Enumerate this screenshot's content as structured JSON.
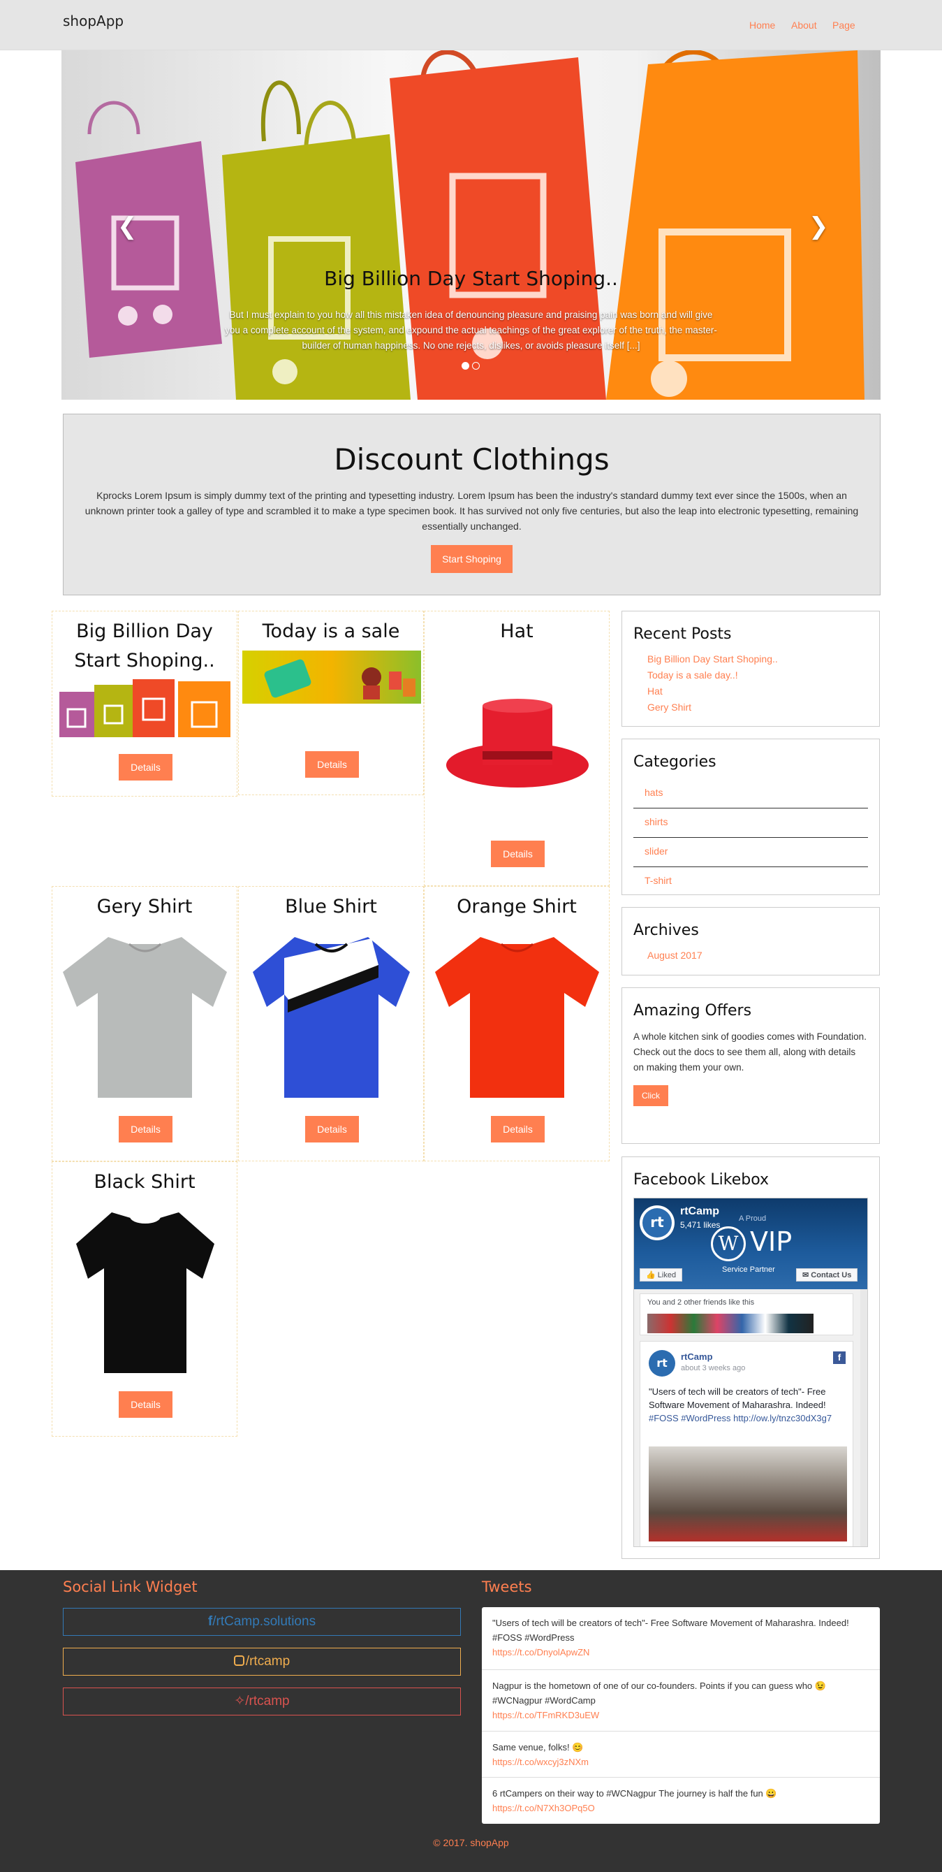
{
  "navbar": {
    "brand": "shopApp",
    "links": [
      "Home",
      "About",
      "Page"
    ]
  },
  "carousel": {
    "title": "Big Billion Day Start Shoping..",
    "text": "But I must explain to you how all this mistaken idea of denouncing pleasure and praising pain was born and will give you a complete account of the system, and expound the actual teachings of the great explorer of the truth, the master-builder of human happiness. No one rejects, dislikes, or avoids pleasure itself [...]",
    "prev_icon": "chevron-left-icon",
    "next_icon": "chevron-right-icon",
    "active_slide": 1,
    "slide_count": 2
  },
  "jumbotron": {
    "title": "Discount Clothings",
    "text": "Kprocks Lorem Ipsum is simply dummy text of the printing and typesetting industry. Lorem Ipsum has been the industry's standard dummy text ever since the 1500s, when an unknown printer took a galley of type and scrambled it to make a type specimen book. It has survived not only five centuries, but also the leap into electronic typesetting, remaining essentially unchanged.",
    "button": "Start Shoping"
  },
  "products": [
    {
      "title": "Big Billion Day Start Shoping..",
      "button": "Details"
    },
    {
      "title": "Today is a sale day..!",
      "button": "Details"
    },
    {
      "title": "Hat",
      "button": "Details"
    },
    {
      "title": "Gery Shirt",
      "button": "Details"
    },
    {
      "title": "Blue Shirt",
      "button": "Details"
    },
    {
      "title": "Orange Shirt",
      "button": "Details"
    },
    {
      "title": "Black Shirt",
      "button": "Details"
    }
  ],
  "sidebar": {
    "recent_posts": {
      "title": "Recent Posts",
      "items": [
        "Big Billion Day Start Shoping..",
        "Today is a sale day..!",
        "Hat",
        "Gery Shirt"
      ]
    },
    "categories": {
      "title": "Categories",
      "items": [
        "hats",
        "shirts",
        "slider",
        "T-shirt"
      ]
    },
    "archives": {
      "title": "Archives",
      "items": [
        "August 2017"
      ]
    },
    "offers": {
      "title": "Amazing Offers",
      "text": "A whole kitchen sink of goodies comes with Foundation. Check out the docs to see them all, along with details on making them your own.",
      "button": "Click"
    },
    "facebook": {
      "title": "Facebook Likebox",
      "page_name": "rtCamp",
      "likes": "5,471 likes",
      "cover_small": "A Proud",
      "cover_big": "VIP",
      "cover_sub": "Service Partner",
      "liked": "Liked",
      "contact": "Contact Us",
      "friends_text": "You and 2 other friends like this",
      "post_author": "rtCamp",
      "post_time": "about 3 weeks ago",
      "post_text": "\"Users of tech will be creators of tech\"- Free Software Movement of Maharashra. Indeed!",
      "post_tags": "#FOSS #WordPress",
      "post_link": "http://ow.ly/tnzc30dX3g7"
    }
  },
  "footer": {
    "social_title": "Social Link Widget",
    "social": [
      {
        "label": "/rtCamp.solutions",
        "icon": "facebook-icon",
        "color": "#337ab7"
      },
      {
        "label": "/rtcamp",
        "icon": "instagram-icon",
        "color": "#f0ad4e"
      },
      {
        "label": "/rtcamp",
        "icon": "twitter-icon",
        "color": "#d9534f"
      }
    ],
    "tweets_title": "Tweets",
    "tweets": [
      {
        "text": "\"Users of tech will be creators of tech\"- Free Software Movement of Maharashra. Indeed! #FOSS #WordPress",
        "link": "https://t.co/DnyolApwZN"
      },
      {
        "text": "Nagpur is the hometown of one of our co-founders. Points if you can guess who 😉 #WCNagpur #WordCamp",
        "link": "https://t.co/TFmRKD3uEW"
      },
      {
        "text": "Same venue, folks! 😊",
        "link": "https://t.co/wxcyj3zNXm"
      },
      {
        "text": "6 rtCampers on their way to #WCNagpur The journey is half the fun 😀",
        "link": "https://t.co/N7Xh3OPq5O"
      }
    ],
    "copyright": "© 2017. shopApp"
  },
  "colors": {
    "accent": "#ff7f50",
    "footer_bg": "#333333",
    "navbar_bg": "#e5e5e5"
  }
}
